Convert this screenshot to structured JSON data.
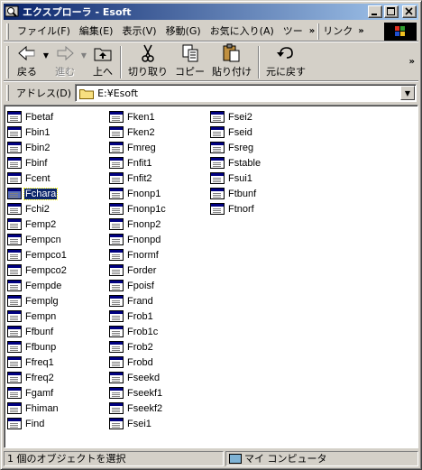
{
  "window": {
    "title": "エクスプローラ - Esoft"
  },
  "menu": {
    "items": [
      "ファイル(F)",
      "編集(E)",
      "表示(V)",
      "移動(G)",
      "お気に入り(A)",
      "ツー"
    ],
    "overflow_chevron": "»",
    "links_label": "リンク",
    "links_chevron": "»"
  },
  "toolbar": {
    "back_label": "戻る",
    "forward_label": "進む",
    "up_label": "上へ",
    "cut_label": "切り取り",
    "copy_label": "コピー",
    "paste_label": "貼り付け",
    "undo_label": "元に戻す",
    "overflow_chevron": "»"
  },
  "address": {
    "label": "アドレス(D)",
    "value": "E:¥Esoft"
  },
  "files": {
    "columns": [
      [
        "Fbetaf",
        "Fbin1",
        "Fbin2",
        "Fbinf",
        "Fcent",
        "Fchara",
        "Fchi2",
        "Femp2",
        "Fempcn",
        "Fempco1",
        "Fempco2",
        "Fempde",
        "Femplg",
        "Fempn",
        "Ffbunf",
        "Ffbunp",
        "Ffreq1",
        "Ffreq2",
        "Fgamf",
        "Fhiman",
        "Find"
      ],
      [
        "Fken1",
        "Fken2",
        "Fmreg",
        "Fnfit1",
        "Fnfit2",
        "Fnonp1",
        "Fnonp1c",
        "Fnonp2",
        "Fnonpd",
        "Fnormf",
        "Forder",
        "Fpoisf",
        "Frand",
        "Frob1",
        "Frob1c",
        "Frob2",
        "Frobd",
        "Fseekd",
        "Fseekf1",
        "Fseekf2",
        "Fsei1"
      ],
      [
        "Fsei2",
        "Fseid",
        "Fsreg",
        "Fstable",
        "Fsui1",
        "Ftbunf",
        "Ftnorf"
      ]
    ],
    "selected": "Fchara"
  },
  "status": {
    "selection_text": "1 個のオブジェクトを選択",
    "location_text": "マイ コンピュータ"
  },
  "colors": {
    "titlebar_start": "#0a246a",
    "titlebar_end": "#a6caf0",
    "chrome": "#d4d0c8",
    "selection": "#0a246a"
  }
}
